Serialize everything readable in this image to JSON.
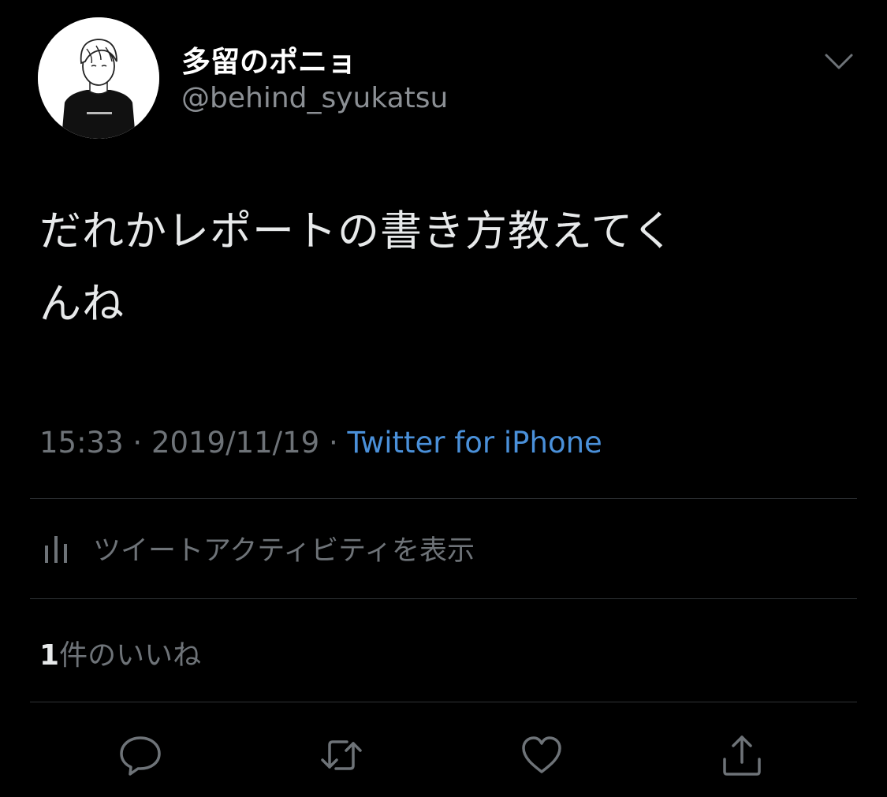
{
  "user": {
    "display_name": "多留のポニョ",
    "handle": "@behind_syukatsu"
  },
  "tweet": {
    "text_line1": "だれかレポートの書き方教えてく",
    "text_line2": "んね"
  },
  "meta": {
    "time": "15:33",
    "separator": " · ",
    "date": "2019/11/19",
    "source": "Twitter for iPhone"
  },
  "activity": {
    "label": "ツイートアクティビティを表示",
    "icon": "bar-chart-icon"
  },
  "likes": {
    "count": "1",
    "label": "件のいいね"
  },
  "actions": {
    "reply_icon": "reply-icon",
    "retweet_icon": "retweet-icon",
    "like_icon": "heart-icon",
    "share_icon": "share-icon"
  },
  "colors": {
    "background": "#000000",
    "link": "#4a90d9",
    "secondary_text": "#6e7378",
    "divider": "#2f3336"
  }
}
